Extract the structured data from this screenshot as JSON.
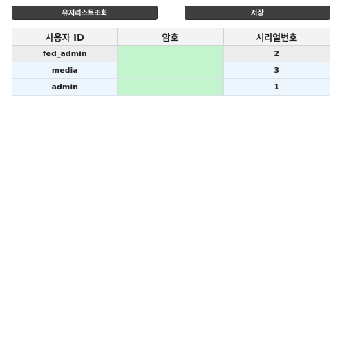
{
  "toolbar": {
    "list_button_label": "유저리스트조회",
    "save_button_label": "저장"
  },
  "grid": {
    "columns": [
      "사용자 ID",
      "암호",
      "시리얼번호"
    ],
    "rows": [
      {
        "user_id": "fed_admin",
        "password": "",
        "serial": "2"
      },
      {
        "user_id": "media",
        "password": "",
        "serial": "3"
      },
      {
        "user_id": "admin",
        "password": "",
        "serial": "1"
      }
    ]
  },
  "colors": {
    "button_bg": "#3f3f3f",
    "password_cell_bg": "#c2f5cd",
    "selected_row_bg": "#ececec",
    "row_bg": "#eef6fd"
  }
}
